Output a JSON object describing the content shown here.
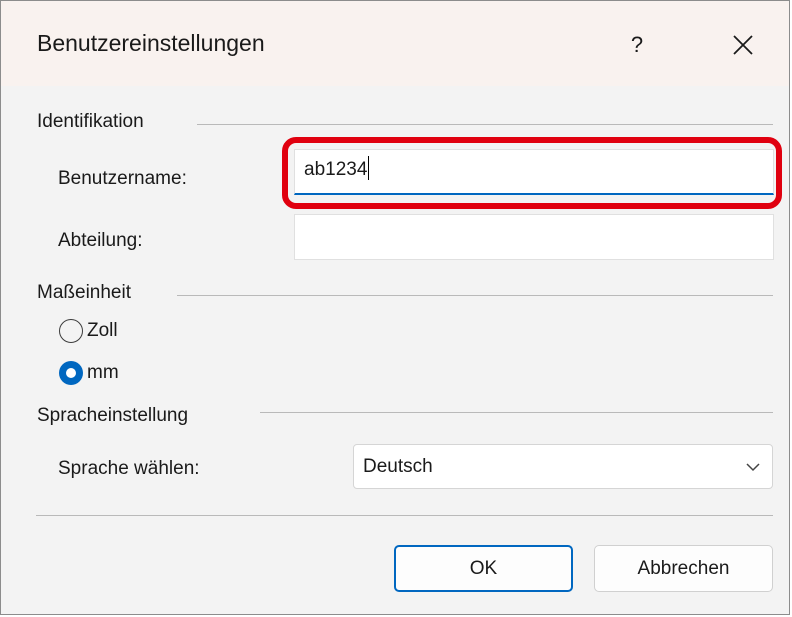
{
  "window": {
    "title": "Benutzereinstellungen",
    "help_label": "?",
    "close_icon": "close-icon"
  },
  "identifikation": {
    "group_label": "Identifikation",
    "username_label": "Benutzername:",
    "username_value": "ab1234",
    "department_label": "Abteilung:",
    "department_value": ""
  },
  "masseinheit": {
    "group_label": "Maßeinheit",
    "options": [
      {
        "label": "Zoll",
        "selected": false
      },
      {
        "label": "mm",
        "selected": true
      }
    ]
  },
  "sprache": {
    "group_label": "Spracheinstellung",
    "select_label": "Sprache wählen:",
    "selected_value": "Deutsch",
    "chevron_icon": "chevron-down-icon"
  },
  "buttons": {
    "ok_label": "OK",
    "cancel_label": "Abbrechen"
  },
  "colors": {
    "accent": "#0067c0",
    "highlight": "#e0000f"
  }
}
